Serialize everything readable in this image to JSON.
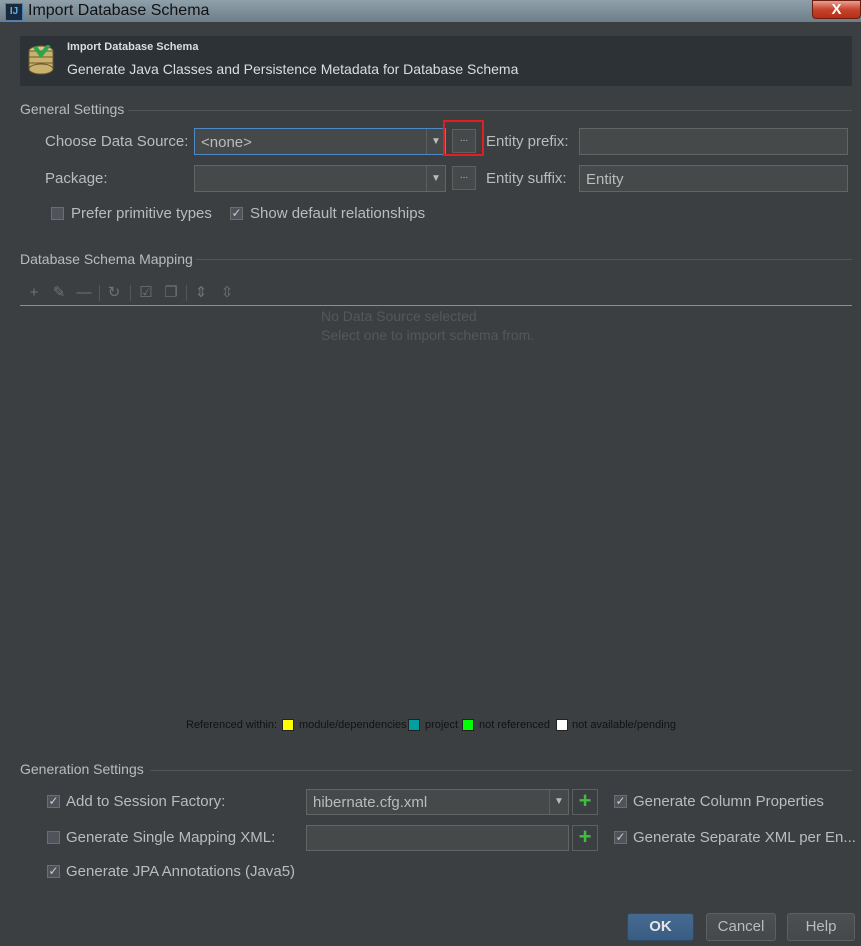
{
  "window": {
    "title": "Import Database Schema",
    "close_glyph": "X",
    "app_icon_glyph": "IJ"
  },
  "header": {
    "title": "Import Database Schema",
    "subtitle": "Generate Java Classes and Persistence Metadata for Database Schema",
    "icon": "database-icon"
  },
  "general": {
    "section_label": "General Settings",
    "data_source_label": "Choose Data Source:",
    "data_source_value": "<none>",
    "package_label": "Package:",
    "package_value": "",
    "entity_prefix_label": "Entity prefix:",
    "entity_prefix_value": "",
    "entity_suffix_label": "Entity suffix:",
    "entity_suffix_value": "Entity",
    "browse_glyph": "...",
    "prefer_primitive_label": "Prefer primitive types",
    "prefer_primitive_checked": false,
    "show_default_rel_label": "Show default relationships",
    "show_default_rel_checked": true
  },
  "mapping": {
    "section_label": "Database Schema Mapping",
    "toolbar_icons": [
      "add-icon",
      "edit-icon",
      "remove-icon",
      "refresh-icon",
      "check-all-icon",
      "copy-icon",
      "expand-all-icon",
      "collapse-all-icon"
    ],
    "toolbar_glyphs": [
      "+",
      "✎",
      "—",
      "↻",
      "☑",
      "❐",
      "⇕",
      "⇳"
    ],
    "empty_line1": "No Data Source selected",
    "empty_line2": "Select one to import schema from.",
    "legend": {
      "prefix": "Referenced within:",
      "items": [
        {
          "label": "module/dependencies",
          "color": "#ffff00"
        },
        {
          "label": "project",
          "color": "#00a0a0"
        },
        {
          "label": "not referenced",
          "color": "#00ff00"
        },
        {
          "label": "not available/pending",
          "color": "#ffffff"
        }
      ]
    }
  },
  "generation": {
    "section_label": "Generation Settings",
    "add_session_label": "Add to Session Factory:",
    "add_session_checked": true,
    "session_value": "hibernate.cfg.xml",
    "single_mapping_label": "Generate Single Mapping XML:",
    "single_mapping_checked": false,
    "single_mapping_value": "",
    "jpa_label": "Generate JPA Annotations (Java5)",
    "jpa_checked": true,
    "column_props_label": "Generate Column Properties",
    "column_props_checked": true,
    "separate_xml_label": "Generate Separate XML per En...",
    "separate_xml_checked": true,
    "plus_glyph": "+"
  },
  "buttons": {
    "ok": "OK",
    "cancel": "Cancel",
    "help": "Help"
  },
  "colors": {
    "background": "#3c3f41",
    "accent": "#4e88c5",
    "highlight": "#e02020"
  }
}
